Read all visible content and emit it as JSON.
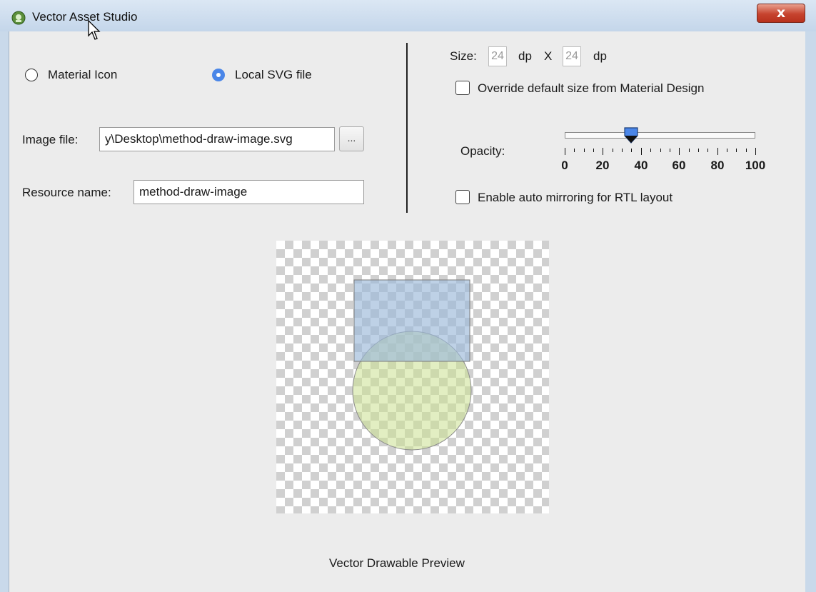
{
  "window": {
    "title": "Vector Asset Studio",
    "close_glyph": "x"
  },
  "source": {
    "material_icon_label": "Material Icon",
    "local_svg_label": "Local SVG file",
    "selected": "Local SVG file"
  },
  "image_file": {
    "label": "Image file:",
    "value": "y\\Desktop\\method-draw-image.svg",
    "browse_label": "..."
  },
  "resource_name": {
    "label": "Resource name:",
    "value": "method-draw-image"
  },
  "size": {
    "label": "Size:",
    "width": "24",
    "height": "24",
    "unit": "dp",
    "separator": "X"
  },
  "override_label": "Override default size from Material Design",
  "opacity": {
    "label": "Opacity:",
    "value": 35,
    "tick_labels": [
      "0",
      "20",
      "40",
      "60",
      "80",
      "100"
    ]
  },
  "mirroring_label": "Enable auto mirroring for RTL layout",
  "preview": {
    "caption": "Vector Drawable Preview",
    "shapes": [
      "rectangle",
      "circle"
    ],
    "colors": {
      "rect_fill": "#a9c3e3",
      "circle_fill": "#cbe08f",
      "accent": "#4a86e8"
    }
  }
}
